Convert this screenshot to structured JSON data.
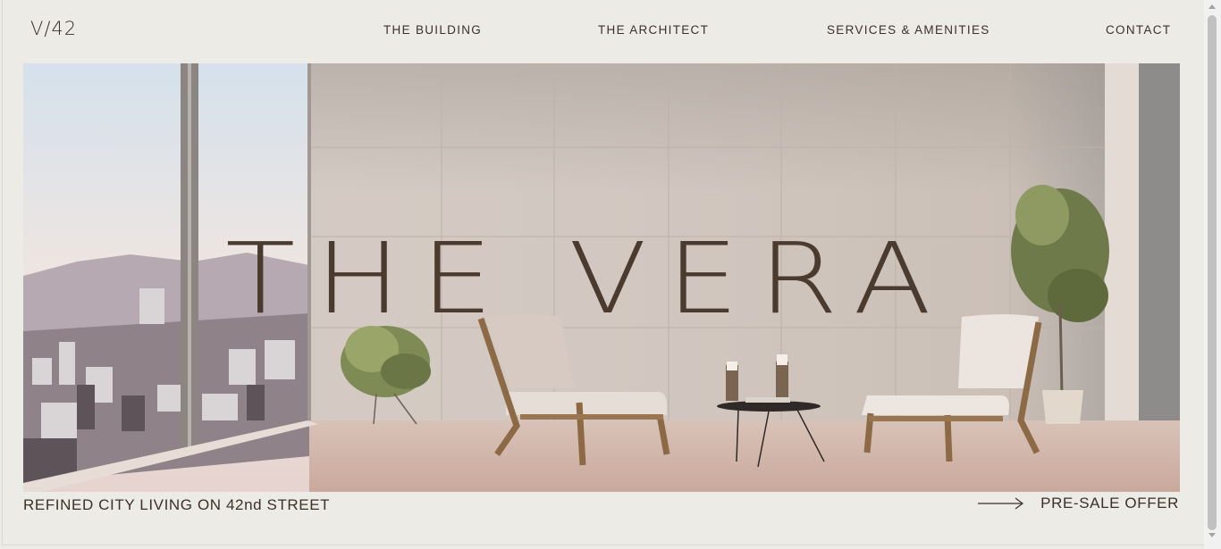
{
  "header": {
    "logo": "V/42",
    "nav": [
      {
        "label": "THE BUILDING"
      },
      {
        "label": "THE ARCHITECT"
      },
      {
        "label": "SERVICES & AMENITIES"
      },
      {
        "label": "CONTACT"
      }
    ]
  },
  "hero": {
    "title": "THE VERA",
    "image_description_icon": "interior-photo"
  },
  "footer": {
    "tagline": "REFINED CITY LIVING ON 42nd STREET",
    "cta_label": "PRE-SALE OFFER",
    "cta_icon": "arrow-right-icon"
  },
  "colors": {
    "background": "#ecebe6",
    "text": "#3b3128",
    "title": "#4a3b2e"
  }
}
